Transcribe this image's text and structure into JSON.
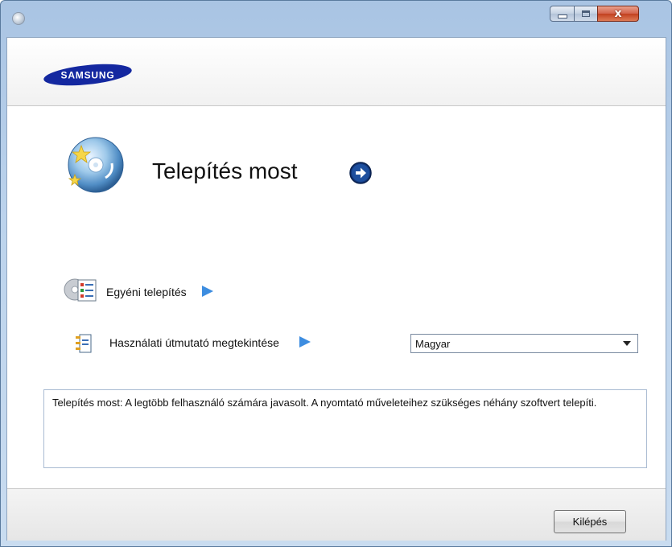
{
  "window": {
    "controls": {
      "minimize_icon": "minimize-icon",
      "maximize_icon": "maximize-icon",
      "close_glyph": "x"
    }
  },
  "header": {
    "logo_text": "SAMSUNG",
    "brand_color": "#1428a0"
  },
  "main": {
    "install_now_label": "Telepítés most",
    "custom_install_label": "Egyéni telepítés",
    "user_guide_label": "Használati útmutató megtekintése",
    "language": {
      "selected": "Magyar"
    },
    "description": "Telepítés most: A legtöbb felhasználó számára javasolt. A nyomtató műveleteihez szükséges néhány szoftvert telepíti."
  },
  "footer": {
    "exit_label": "Kilépés"
  },
  "colors": {
    "arrow_blue": "#3d8de0",
    "title_bar": "#bcd3ec",
    "close_button": "#c2401f"
  }
}
